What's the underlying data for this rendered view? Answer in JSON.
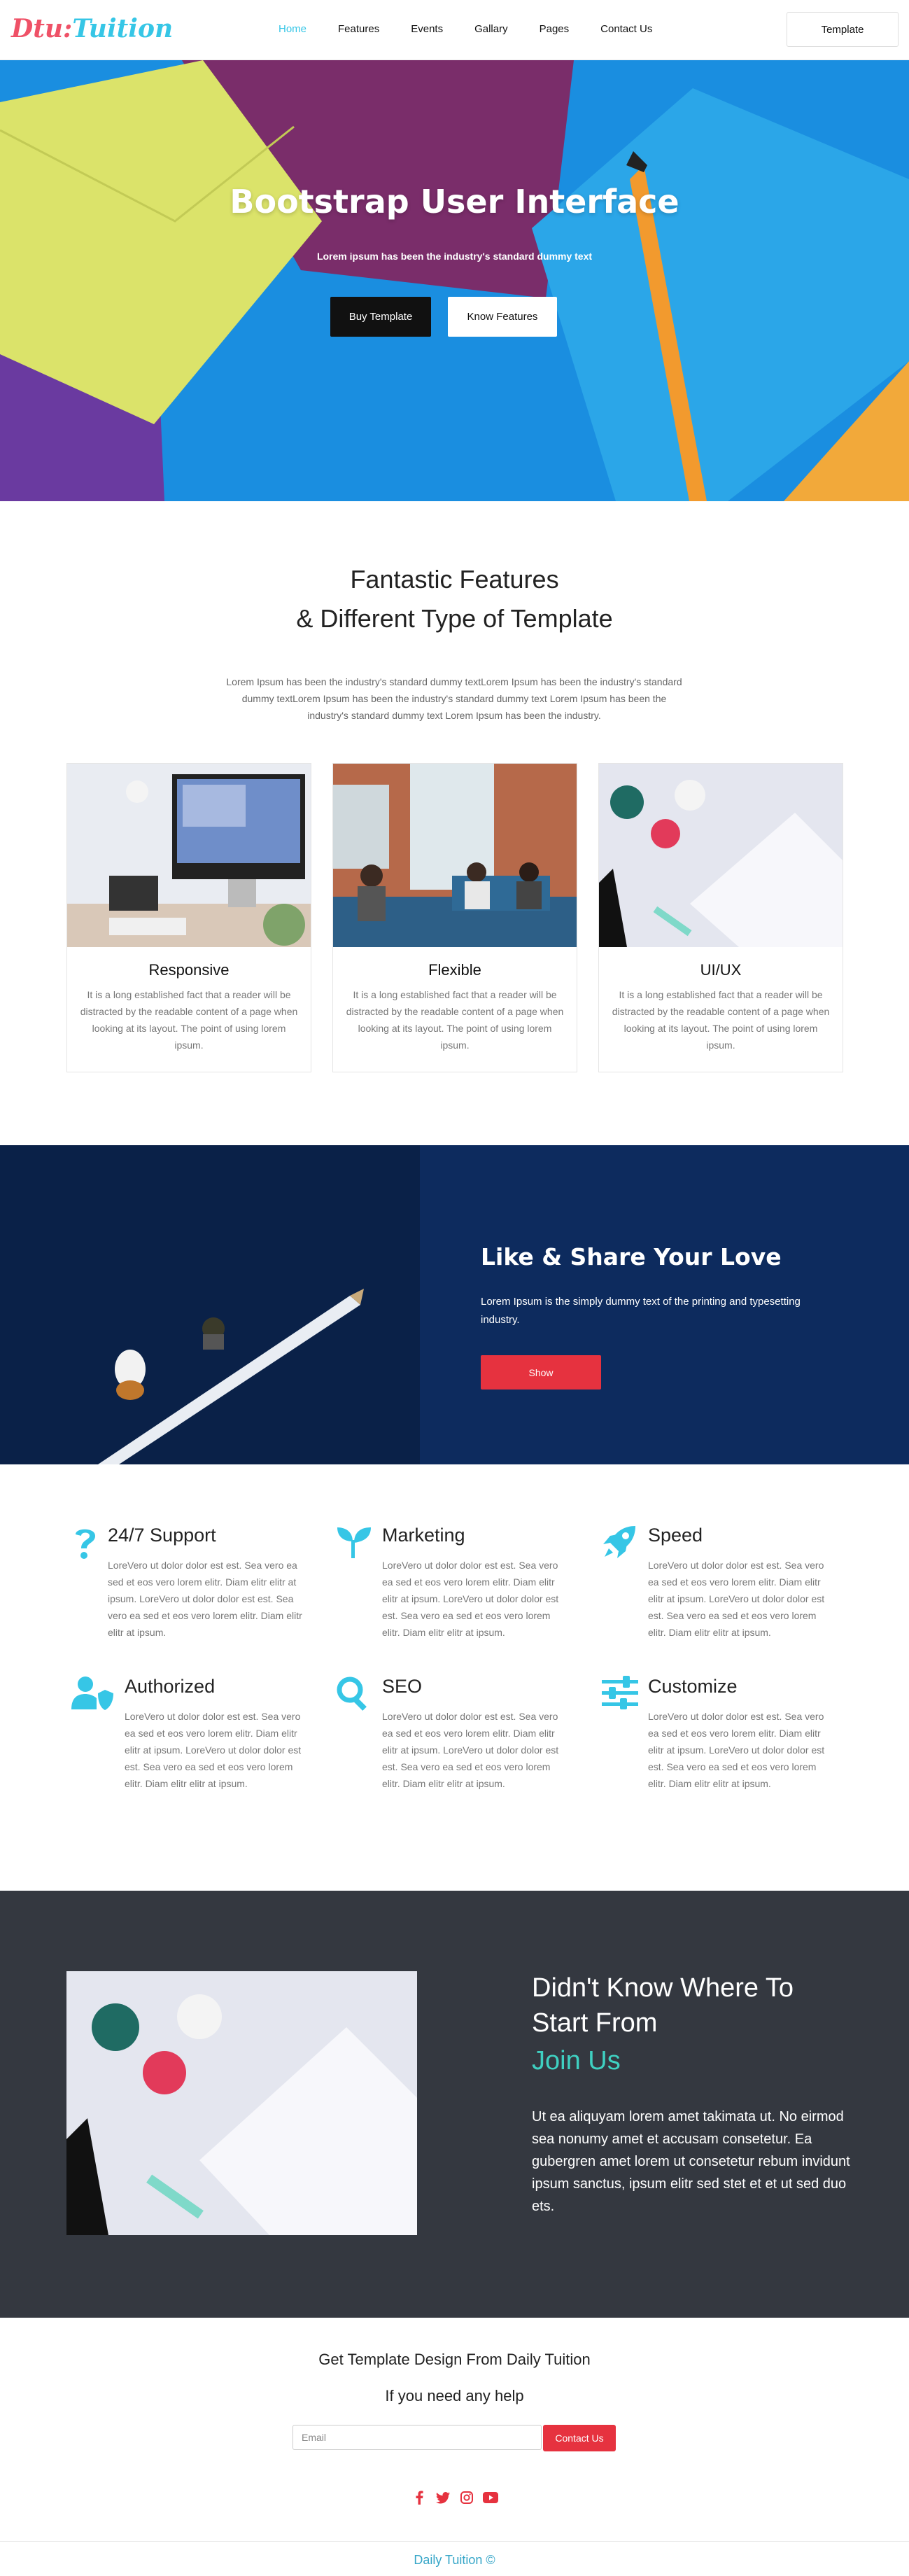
{
  "brand": {
    "logo_part1": "Dtu:",
    "logo_part2": "Tuition",
    "primary_color": "#36c6e6",
    "accent_red": "#e6323f"
  },
  "nav": {
    "items": [
      "Home",
      "Features",
      "Events",
      "Gallary",
      "Pages",
      "Contact Us"
    ],
    "active": "Home",
    "cta_label": "Template"
  },
  "hero": {
    "title": "Bootstrap User Interface",
    "subtitle": "Lorem ipsum has been the industry's standard dummy text",
    "buttons": [
      "Buy Template",
      "Know Features"
    ]
  },
  "features": {
    "title_line1": "Fantastic Features",
    "title_line2": "& Different Type of Template",
    "description": "Lorem Ipsum has been the industry's standard dummy textLorem Ipsum has been the industry's standard dummy textLorem Ipsum has been the industry's standard dummy text Lorem Ipsum has been the industry's standard dummy text Lorem Ipsum has been the industry.",
    "cards": [
      {
        "title": "Responsive",
        "text": "It is a long established fact that a reader will be distracted by the readable content of a page when looking at its layout. The point of using lorem ipsum."
      },
      {
        "title": "Flexible",
        "text": "It is a long established fact that a reader will be distracted by the readable content of a page when looking at its layout. The point of using lorem ipsum."
      },
      {
        "title": "UI/UX",
        "text": "It is a long established fact that a reader will be distracted by the readable content of a page when looking at its layout. The point of using lorem ipsum."
      }
    ]
  },
  "like_section": {
    "title": "Like & Share Your Love",
    "text": "Lorem Ipsum is the simply dummy text of the printing and typesetting industry.",
    "button": "Show"
  },
  "services": [
    {
      "title": "24/7 Support",
      "icon": "question-icon",
      "text": "LoreVero ut dolor dolor est est. Sea vero ea sed et eos vero lorem elitr. Diam elitr elitr at ipsum. LoreVero ut dolor dolor est est. Sea vero ea sed et eos vero lorem elitr. Diam elitr elitr at ipsum."
    },
    {
      "title": "Marketing",
      "icon": "seedling-icon",
      "text": "LoreVero ut dolor dolor est est. Sea vero ea sed et eos vero lorem elitr. Diam elitr elitr at ipsum. LoreVero ut dolor dolor est est. Sea vero ea sed et eos vero lorem elitr. Diam elitr elitr at ipsum."
    },
    {
      "title": "Speed",
      "icon": "rocket-icon",
      "text": "LoreVero ut dolor dolor est est. Sea vero ea sed et eos vero lorem elitr. Diam elitr elitr at ipsum. LoreVero ut dolor dolor est est. Sea vero ea sed et eos vero lorem elitr. Diam elitr elitr at ipsum."
    },
    {
      "title": "Authorized",
      "icon": "user-shield-icon",
      "text": "LoreVero ut dolor dolor est est. Sea vero ea sed et eos vero lorem elitr. Diam elitr elitr at ipsum. LoreVero ut dolor dolor est est. Sea vero ea sed et eos vero lorem elitr. Diam elitr elitr at ipsum."
    },
    {
      "title": "SEO",
      "icon": "search-icon",
      "text": "LoreVero ut dolor dolor est est. Sea vero ea sed et eos vero lorem elitr. Diam elitr elitr at ipsum. LoreVero ut dolor dolor est est. Sea vero ea sed et eos vero lorem elitr. Diam elitr elitr at ipsum."
    },
    {
      "title": "Customize",
      "icon": "sliders-icon",
      "text": "LoreVero ut dolor dolor est est. Sea vero ea sed et eos vero lorem elitr. Diam elitr elitr at ipsum. LoreVero ut dolor dolor est est. Sea vero ea sed et eos vero lorem elitr. Diam elitr elitr at ipsum."
    }
  ],
  "join": {
    "title": "Didn't Know Where To Start From",
    "subtitle": "Join Us",
    "text": "Ut ea aliquyam lorem amet takimata ut. No eirmod sea nonumy amet et accusam consetetur. Ea gubergren amet lorem ut consetetur rebum invidunt ipsum sanctus, ipsum elitr sed stet et et ut sed duo ets."
  },
  "newsletter": {
    "title": "Get Template Design From Daily Tuition",
    "subtitle": "If you need any help",
    "email_placeholder": "Email",
    "button": "Contact Us"
  },
  "social": [
    "facebook-icon",
    "twitter-icon",
    "instagram-icon",
    "youtube-icon"
  ],
  "footer": {
    "copyright": "Daily Tuition ©"
  }
}
